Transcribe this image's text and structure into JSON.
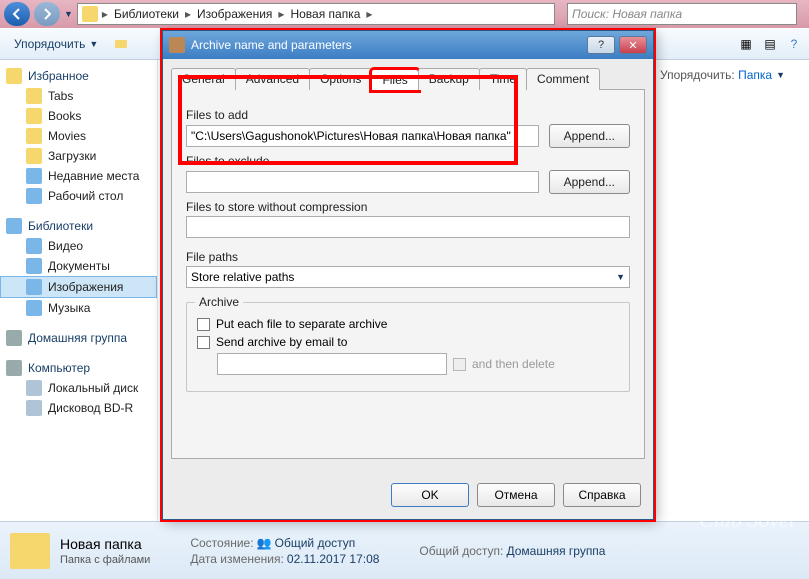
{
  "explorer": {
    "breadcrumb": [
      "Библиотеки",
      "Изображения",
      "Новая папка"
    ],
    "search_placeholder": "Поиск: Новая папка",
    "toolbar": {
      "organize": "Упорядочить"
    },
    "right_panel": {
      "sort_label": "Упорядочить:",
      "sort_value": "Папка"
    }
  },
  "sidebar": {
    "favorites": {
      "label": "Избранное",
      "items": [
        "Tabs",
        "Books",
        "Movies",
        "Загрузки",
        "Недавние места",
        "Рабочий стол"
      ]
    },
    "libraries": {
      "label": "Библиотеки",
      "items": [
        "Видео",
        "Документы",
        "Изображения",
        "Музыка"
      ]
    },
    "homegroup": {
      "label": "Домашняя группа"
    },
    "computer": {
      "label": "Компьютер",
      "items": [
        "Локальный диск",
        "Дисковод BD-R"
      ]
    }
  },
  "status": {
    "folder_name": "Новая папка",
    "subtitle": "Папка с файлами",
    "state_key": "Состояние:",
    "state_val": "Общий доступ",
    "date_key": "Дата изменения:",
    "date_val": "02.11.2017 17:08",
    "access_key": "Общий доступ:",
    "access_val": "Домашняя группа"
  },
  "dialog": {
    "title": "Archive name and parameters",
    "tabs": [
      "General",
      "Advanced",
      "Options",
      "Files",
      "Backup",
      "Time",
      "Comment"
    ],
    "files_to_add_label": "Files to add",
    "files_to_add_value": "\"C:\\Users\\Gagushonok\\Pictures\\Новая папка\\Новая папка\"",
    "append": "Append...",
    "files_to_exclude_label": "Files to exclude",
    "files_to_store_label": "Files to store without compression",
    "file_paths_label": "File paths",
    "file_paths_value": "Store relative paths",
    "archive_group": "Archive",
    "chk_separate": "Put each file to separate archive",
    "chk_email": "Send archive by email to",
    "and_then_delete": "and then delete",
    "ok": "OK",
    "cancel": "Отмена",
    "help": "Справка"
  },
  "watermark": "Club Sovet"
}
